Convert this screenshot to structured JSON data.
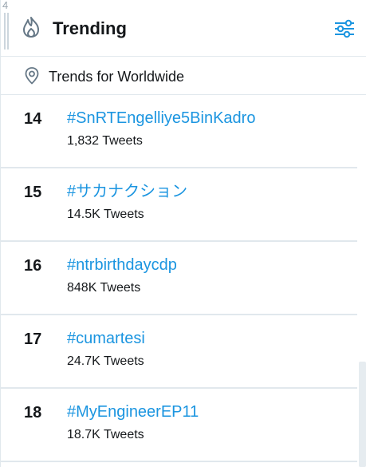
{
  "column": {
    "number": "4"
  },
  "header": {
    "title": "Trending",
    "icon": "flame-icon",
    "settings_icon": "sliders-icon"
  },
  "location": {
    "icon": "map-pin-icon",
    "label": "Trends for Worldwide"
  },
  "trends": [
    {
      "rank": "14",
      "name": "#SnRTEngelliye5BinKadro",
      "count": "1,832 Tweets"
    },
    {
      "rank": "15",
      "name": "#サカナクション",
      "count": "14.5K Tweets"
    },
    {
      "rank": "16",
      "name": "#ntrbirthdaycdp",
      "count": "848K Tweets"
    },
    {
      "rank": "17",
      "name": "#cumartesi",
      "count": "24.7K Tweets"
    },
    {
      "rank": "18",
      "name": "#MyEngineerEP11",
      "count": "18.7K Tweets"
    }
  ],
  "colors": {
    "link": "#1b95e0",
    "text": "#14171a",
    "border": "#e1e8ed",
    "icon": "#657786"
  }
}
